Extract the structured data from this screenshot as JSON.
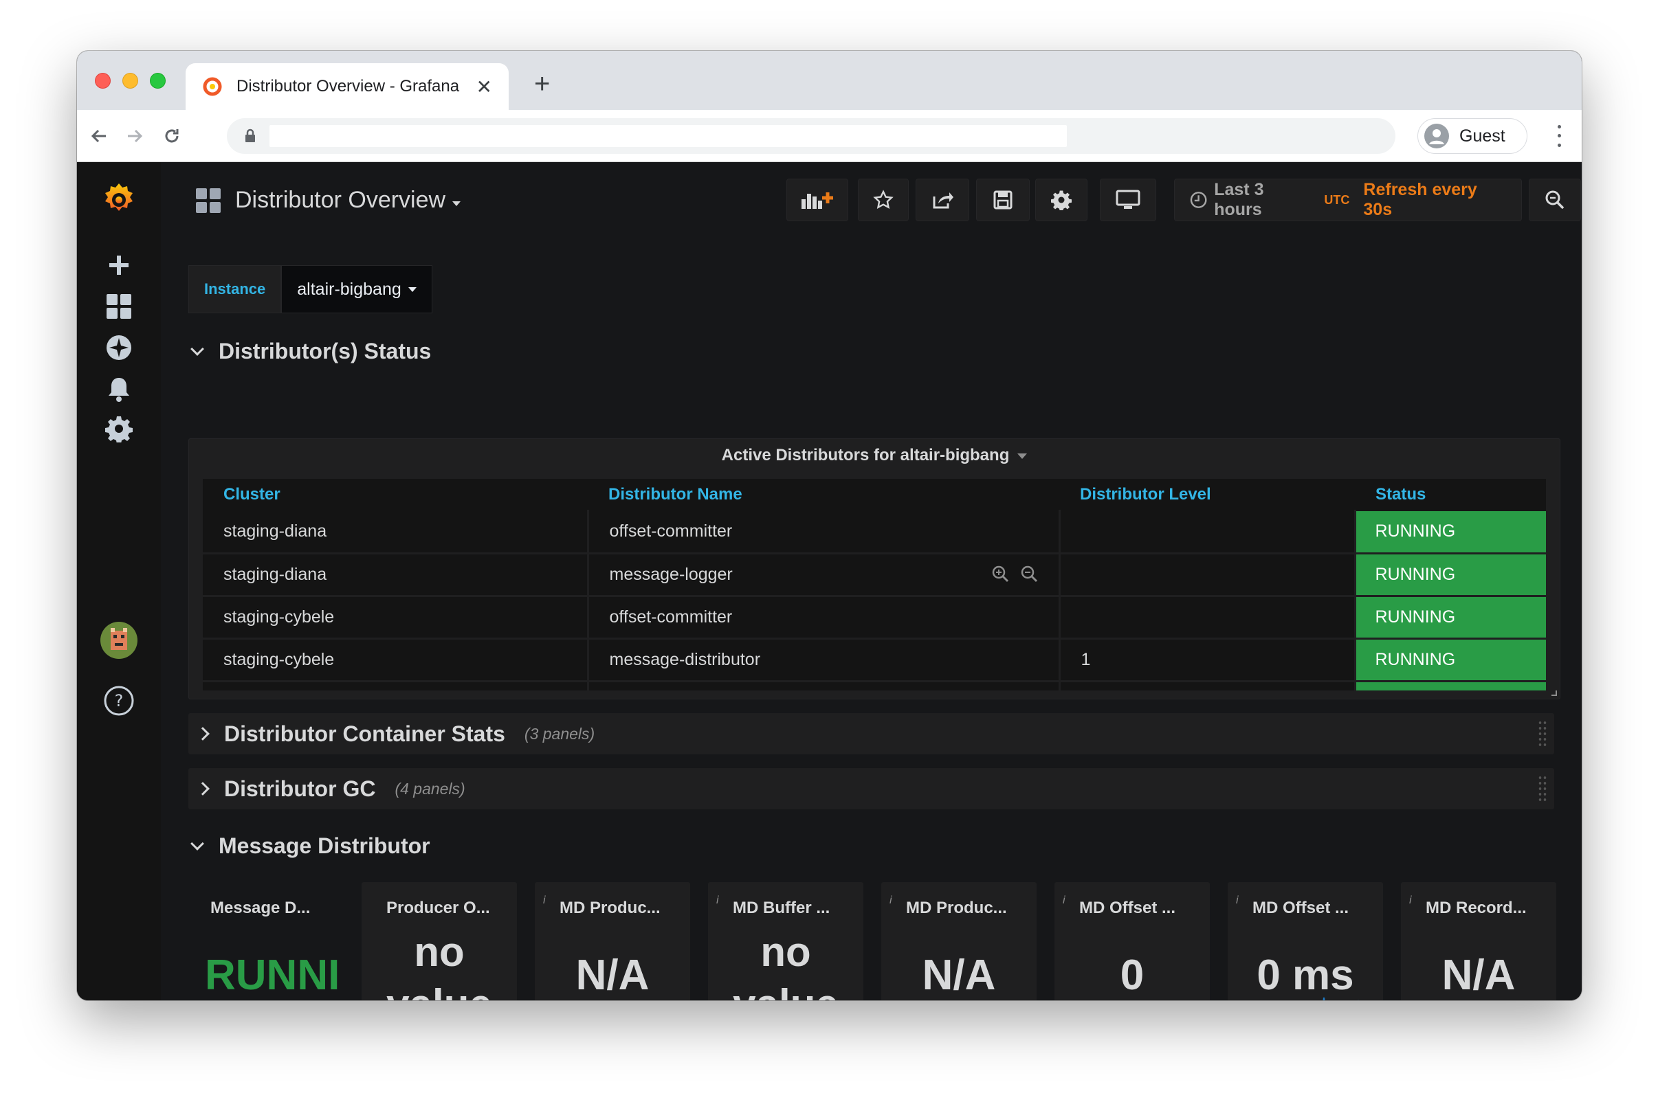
{
  "browser": {
    "tab_title": "Distributor Overview - Grafana",
    "profile_label": "Guest"
  },
  "dashboard": {
    "title": "Distributor Overview",
    "time_range": "Last 3 hours",
    "timezone": "UTC",
    "refresh": "Refresh every 30s"
  },
  "variable": {
    "label": "Instance",
    "value": "altair-bigbang"
  },
  "rows": {
    "status": {
      "title": "Distributor(s) Status"
    },
    "container": {
      "title": "Distributor Container Stats",
      "count": "(3 panels)"
    },
    "gc": {
      "title": "Distributor GC",
      "count": "(4 panels)"
    },
    "message": {
      "title": "Message Distributor"
    }
  },
  "table": {
    "title": "Active Distributors for altair-bigbang",
    "columns": [
      "Cluster",
      "Distributor Name",
      "Distributor Level",
      "Status"
    ],
    "rows": [
      [
        "staging-diana",
        "offset-committer",
        "",
        "RUNNING"
      ],
      [
        "staging-diana",
        "message-logger",
        "",
        "RUNNING"
      ],
      [
        "staging-cybele",
        "offset-committer",
        "",
        "RUNNING"
      ],
      [
        "staging-cybele",
        "message-distributor",
        "1",
        "RUNNING"
      ]
    ]
  },
  "stats": [
    {
      "title": "Message D...",
      "value": "RUNNIN",
      "info": ""
    },
    {
      "title": "Producer O...",
      "value": "no value",
      "info": ""
    },
    {
      "title": "MD Produc...",
      "value": "N/A",
      "info": "i"
    },
    {
      "title": "MD Buffer ...",
      "value": "no value",
      "info": "i"
    },
    {
      "title": "MD Produc...",
      "value": "N/A",
      "info": "i"
    },
    {
      "title": "MD Offset ...",
      "value": "0",
      "info": "i"
    },
    {
      "title": "MD Offset ...",
      "value": "0 ms",
      "info": "i"
    },
    {
      "title": "MD Record...",
      "value": "N/A",
      "info": "i"
    }
  ],
  "colors": {
    "running_green": "#299c46",
    "accent_orange": "#eb7b18",
    "link_blue": "#33b5e5"
  }
}
